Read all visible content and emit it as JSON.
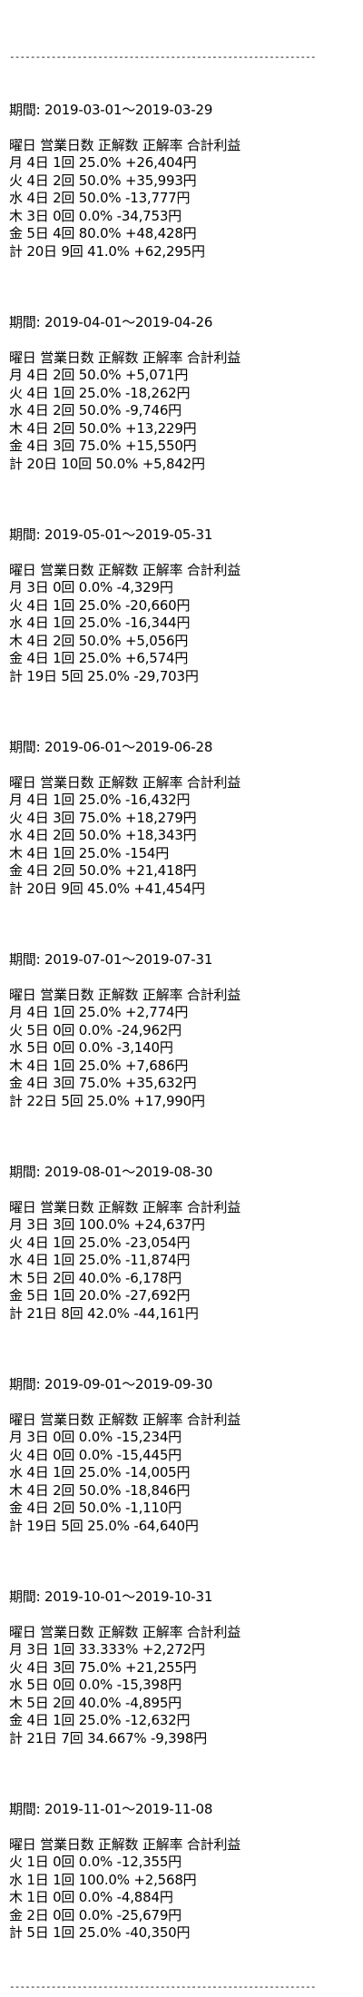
{
  "rule": "-----------------------------------------------------------",
  "sections": [
    {
      "period": "期間: 2019-03-01～2019-03-29",
      "header": "曜日 営業日数 正解数 正解率 合計利益",
      "rows": [
        "月 4日 1回 25.0% +26,404円",
        "火 4日 2回 50.0% +35,993円",
        "水 4日 2回 50.0% -13,777円",
        "木 3日 0回 0.0% -34,753円",
        "金 5日 4回 80.0% +48,428円",
        "計 20日 9回 41.0% +62,295円"
      ]
    },
    {
      "period": "期間: 2019-04-01～2019-04-26",
      "header": "曜日 営業日数 正解数 正解率 合計利益",
      "rows": [
        "月 4日 2回 50.0% +5,071円",
        "火 4日 1回 25.0% -18,262円",
        "水 4日 2回 50.0% -9,746円",
        "木 4日 2回 50.0% +13,229円",
        "金 4日 3回 75.0% +15,550円",
        "計 20日 10回 50.0% +5,842円"
      ]
    },
    {
      "period": "期間: 2019-05-01～2019-05-31",
      "header": "曜日 営業日数 正解数 正解率 合計利益",
      "rows": [
        "月 3日 0回 0.0% -4,329円",
        "火 4日 1回 25.0% -20,660円",
        "水 4日 1回 25.0% -16,344円",
        "木 4日 2回 50.0% +5,056円",
        "金 4日 1回 25.0% +6,574円",
        "計 19日 5回 25.0% -29,703円"
      ]
    },
    {
      "period": "期間: 2019-06-01～2019-06-28",
      "header": "曜日 営業日数 正解数 正解率 合計利益",
      "rows": [
        "月 4日 1回 25.0% -16,432円",
        "火 4日 3回 75.0% +18,279円",
        "水 4日 2回 50.0% +18,343円",
        "木 4日 1回 25.0% -154円",
        "金 4日 2回 50.0% +21,418円",
        "計 20日 9回 45.0% +41,454円"
      ]
    },
    {
      "period": "期間: 2019-07-01～2019-07-31",
      "header": "曜日 営業日数 正解数 正解率 合計利益",
      "rows": [
        "月 4日 1回 25.0% +2,774円",
        "火 5日 0回 0.0% -24,962円",
        "水 5日 0回 0.0% -3,140円",
        "木 4日 1回 25.0% +7,686円",
        "金 4日 3回 75.0% +35,632円",
        "計 22日 5回 25.0% +17,990円"
      ]
    },
    {
      "period": "期間: 2019-08-01～2019-08-30",
      "header": "曜日 営業日数 正解数 正解率 合計利益",
      "rows": [
        "月 3日 3回 100.0% +24,637円",
        "火 4日 1回 25.0% -23,054円",
        "水 4日 1回 25.0% -11,874円",
        "木 5日 2回 40.0% -6,178円",
        "金 5日 1回 20.0% -27,692円",
        "計 21日 8回 42.0% -44,161円"
      ]
    },
    {
      "period": "期間: 2019-09-01～2019-09-30",
      "header": "曜日 営業日数 正解数 正解率 合計利益",
      "rows": [
        "月 3日 0回 0.0% -15,234円",
        "火 4日 0回 0.0% -15,445円",
        "水 4日 1回 25.0% -14,005円",
        "木 4日 2回 50.0% -18,846円",
        "金 4日 2回 50.0% -1,110円",
        "計 19日 5回 25.0% -64,640円"
      ]
    },
    {
      "period": "期間: 2019-10-01～2019-10-31",
      "header": "曜日 営業日数 正解数 正解率 合計利益",
      "rows": [
        "月 3日 1回 33.333% +2,272円",
        "火 4日 3回 75.0% +21,255円",
        "水 5日 0回 0.0% -15,398円",
        "木 5日 2回 40.0% -4,895円",
        "金 4日 1回 25.0% -12,632円",
        "計 21日 7回 34.667% -9,398円"
      ]
    },
    {
      "period": "期間: 2019-11-01～2019-11-08",
      "header": "曜日 営業日数 正解数 正解率 合計利益",
      "rows": [
        "火 1日 0回 0.0% -12,355円",
        "水 1日 1回 100.0% +2,568円",
        "木 1日 0回 0.0% -4,884円",
        "金 2日 0回 0.0% -25,679円",
        "計 5日 1回 25.0% -40,350円"
      ]
    }
  ]
}
